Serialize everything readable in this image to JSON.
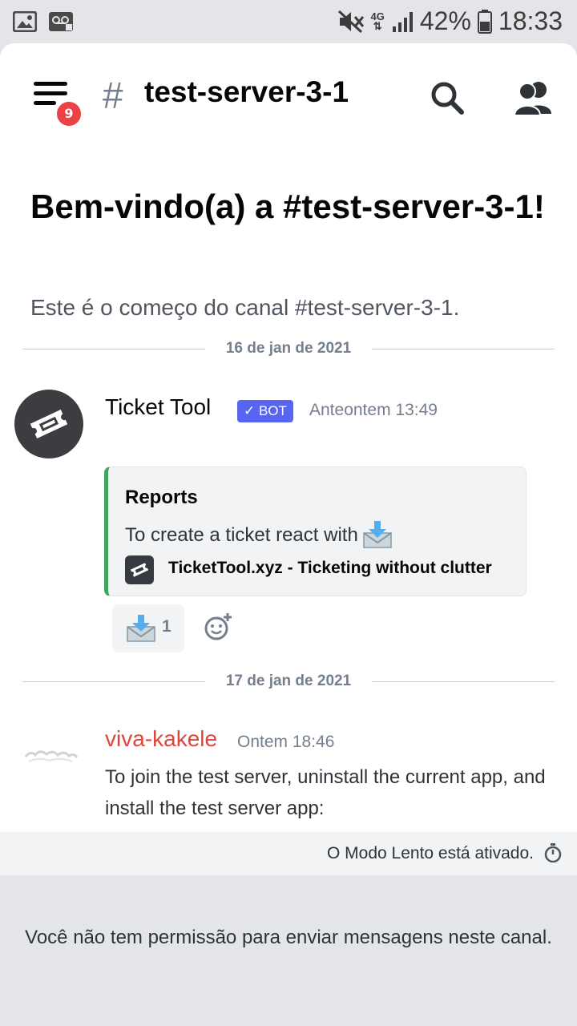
{
  "status_bar": {
    "network": "4G",
    "battery": "42%",
    "time": "18:33",
    "icons": [
      "image-icon",
      "voicemail-icon",
      "mute-icon",
      "signal-icon",
      "battery-icon"
    ]
  },
  "header": {
    "menu_badge": "9",
    "channel_hash": "#",
    "channel_name": "test-server-3-1"
  },
  "welcome": {
    "title": "Bem-vindo(a) a #test-server-3-1!",
    "subtitle": "Este é o começo do canal #test-server-3-1."
  },
  "messages": [
    {
      "date_divider": "16 de jan de 2021",
      "author": "Ticket Tool",
      "bot_tag": "✓ BOT",
      "timestamp": "Anteontem 13:49",
      "embed": {
        "title": "Reports",
        "description": "To create a ticket react with",
        "footer": "TicketTool.xyz - Ticketing without clutter",
        "border_color": "#3ba55c"
      },
      "reaction": {
        "count": "1"
      }
    },
    {
      "date_divider": "17 de jan de 2021",
      "author": "viva-kakele",
      "author_color": "#e0453b",
      "timestamp": "Ontem 18:46",
      "text": "To join the test server, uninstall the current app, and install the test server app:"
    }
  ],
  "slowmode": {
    "text": "O Modo Lento está ativado."
  },
  "composer": {
    "no_permission": "Você não tem permissão para enviar mensagens neste canal."
  },
  "colors": {
    "accent": "#5865f2",
    "badge": "#ed4245",
    "embed_border": "#3ba55c"
  }
}
